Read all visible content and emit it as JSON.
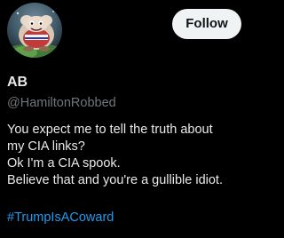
{
  "profile": {
    "display_name": "AB",
    "handle": "@HamiltonRobbed",
    "follow_label": "Follow"
  },
  "tweet": {
    "lines": [
      "You expect me to tell the truth about",
      "my CIA links?",
      "Ok I'm a CIA spook.",
      "Believe that and you're a gullible idiot."
    ],
    "hashtag": "#TrumpIsACoward"
  },
  "colors": {
    "background": "#000000",
    "text_primary": "#e7e9ea",
    "text_secondary": "#71767b",
    "link": "#1d9bf0",
    "button_bg": "#eff3f4",
    "button_text": "#0f1419"
  }
}
